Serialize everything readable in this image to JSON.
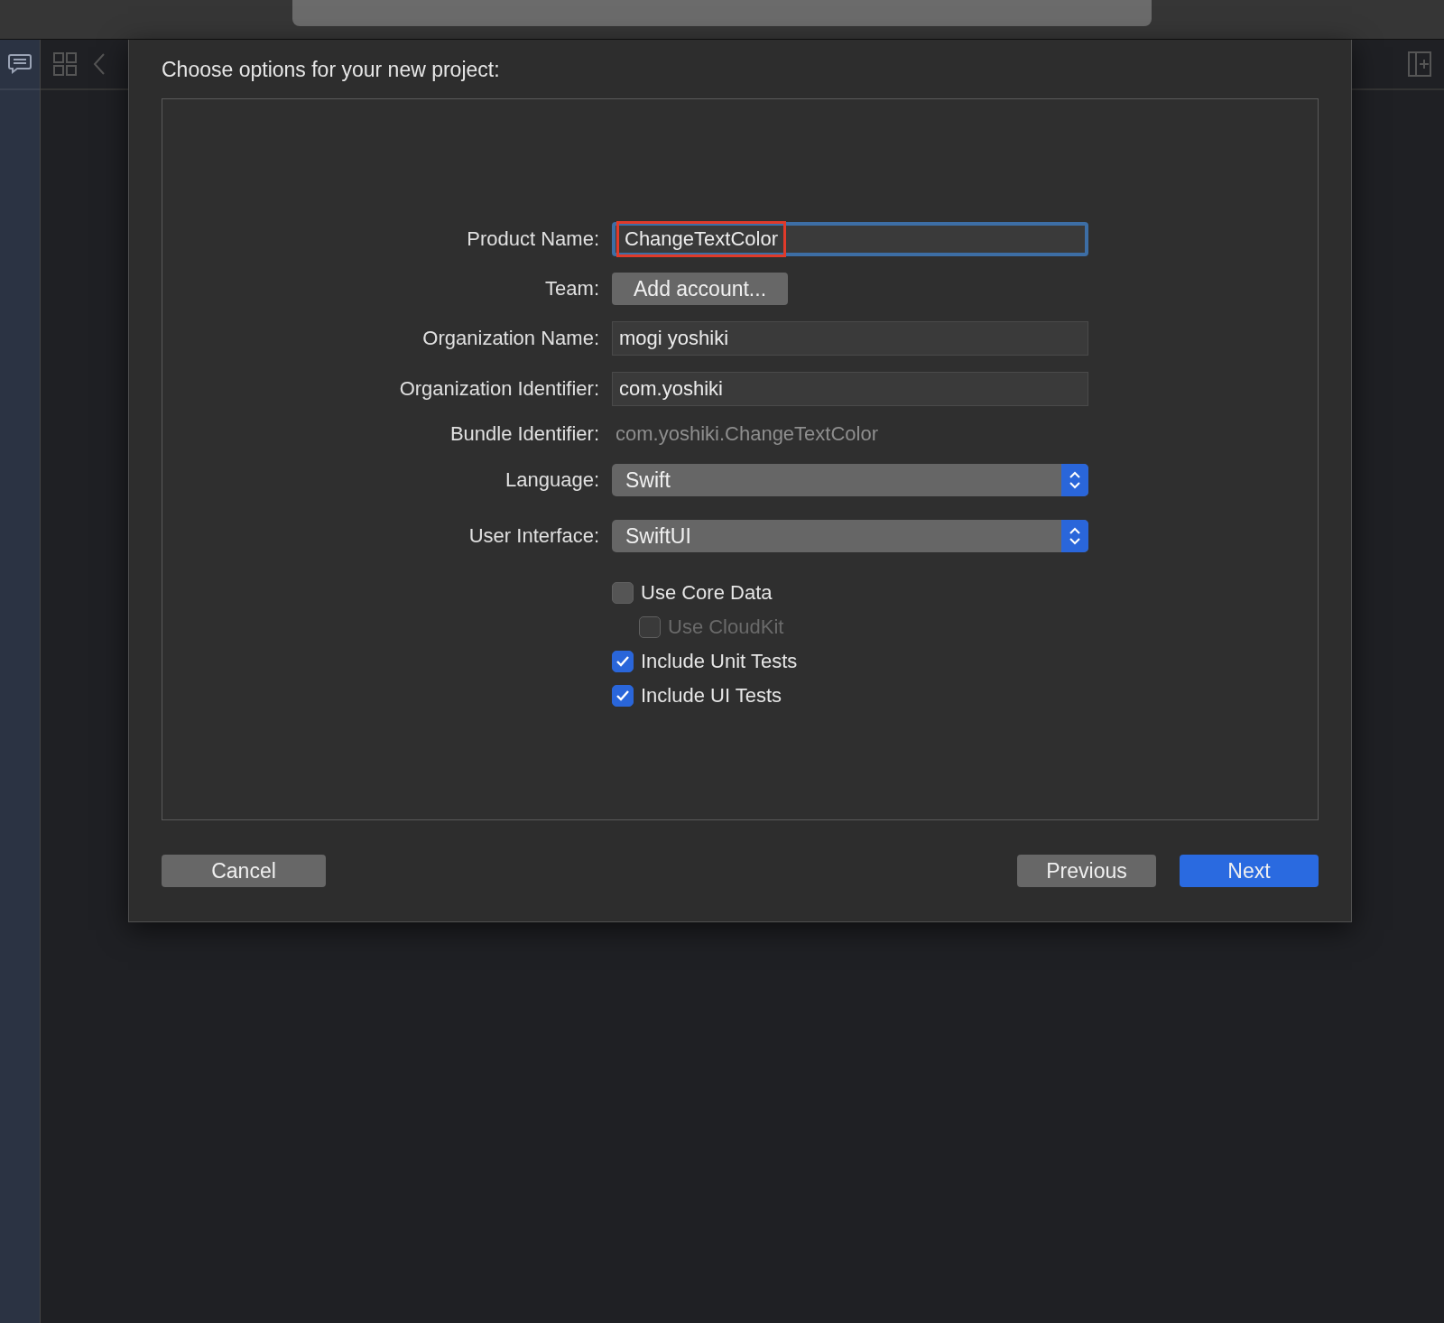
{
  "dialog": {
    "title": "Choose options for your new project:",
    "fields": [
      {
        "kind": "text",
        "label": "Product Name:",
        "value": "ChangeTextColor",
        "focused": true,
        "highlighted": true
      },
      {
        "kind": "button",
        "label": "Team:",
        "value": "Add account..."
      },
      {
        "kind": "text",
        "label": "Organization Name:",
        "value": "mogi yoshiki",
        "focused": false,
        "highlighted": false
      },
      {
        "kind": "text",
        "label": "Organization Identifier:",
        "value": "com.yoshiki",
        "focused": false,
        "highlighted": false
      },
      {
        "kind": "static",
        "label": "Bundle Identifier:",
        "value": "com.yoshiki.ChangeTextColor"
      },
      {
        "kind": "popup",
        "label": "Language:",
        "value": "Swift"
      },
      {
        "kind": "popup",
        "label": "User Interface:",
        "value": "SwiftUI"
      }
    ],
    "options": [
      {
        "label": "Use Core Data",
        "checked": false,
        "disabled": false,
        "children": [
          {
            "label": "Use CloudKit",
            "checked": false,
            "disabled": true
          }
        ]
      },
      {
        "label": "Include Unit Tests",
        "checked": true,
        "disabled": false
      },
      {
        "label": "Include UI Tests",
        "checked": true,
        "disabled": false
      }
    ],
    "left_buttons": [
      {
        "label": "Cancel",
        "primary": false
      }
    ],
    "right_buttons": [
      {
        "label": "Previous",
        "primary": false
      },
      {
        "label": "Next",
        "primary": true
      }
    ]
  }
}
